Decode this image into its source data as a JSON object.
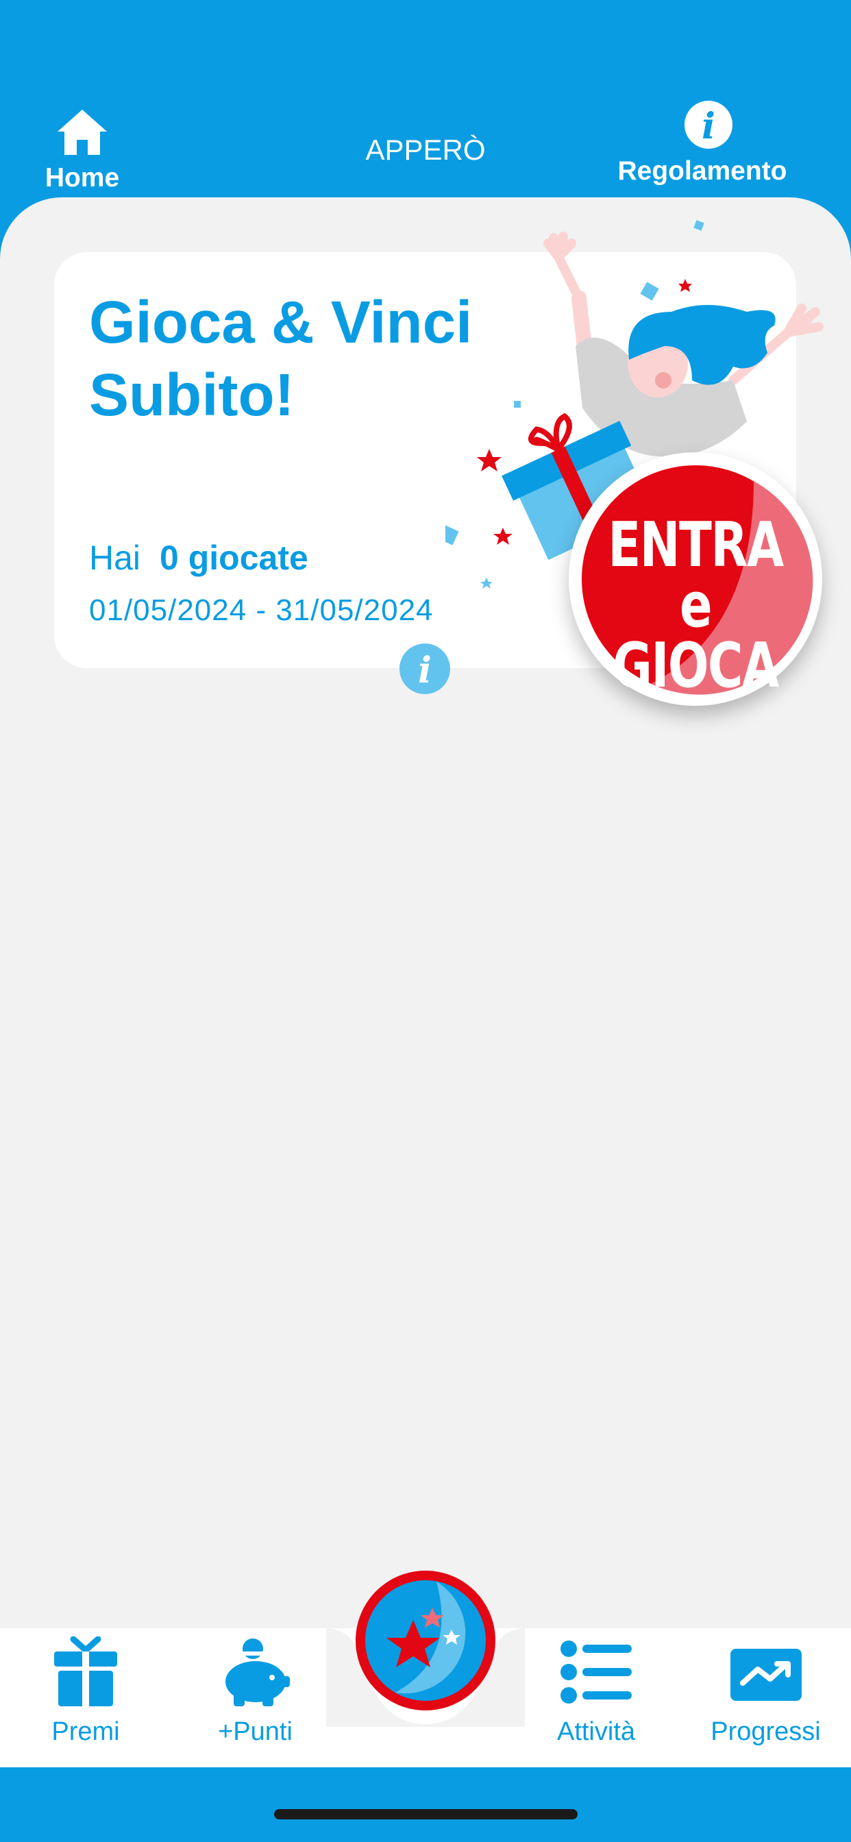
{
  "header": {
    "home_label": "Home",
    "app_title": "APPERÒ",
    "rules_label": "Regolamento"
  },
  "game_card": {
    "title_line1": "Gioca & Vinci",
    "title_line2": "Subito!",
    "plays_prefix": "Hai",
    "plays_count": "0 giocate",
    "date_range": "01/05/2024 - 31/05/2024",
    "play_button_line1": "ENTRA e",
    "play_button_line2": "GIOCA"
  },
  "bottom_nav": {
    "premi": "Premi",
    "punti": "+Punti",
    "attivita": "Attività",
    "progressi": "Progressi"
  },
  "colors": {
    "brand_blue": "#0a9ce2",
    "light_blue": "#62c3ee",
    "red": "#e30613",
    "background": "#f2f2f2"
  },
  "icons": [
    "home-icon",
    "info-icon",
    "gift-icon",
    "piggy-bank-icon",
    "star-game-icon",
    "list-icon",
    "progress-chart-icon"
  ]
}
